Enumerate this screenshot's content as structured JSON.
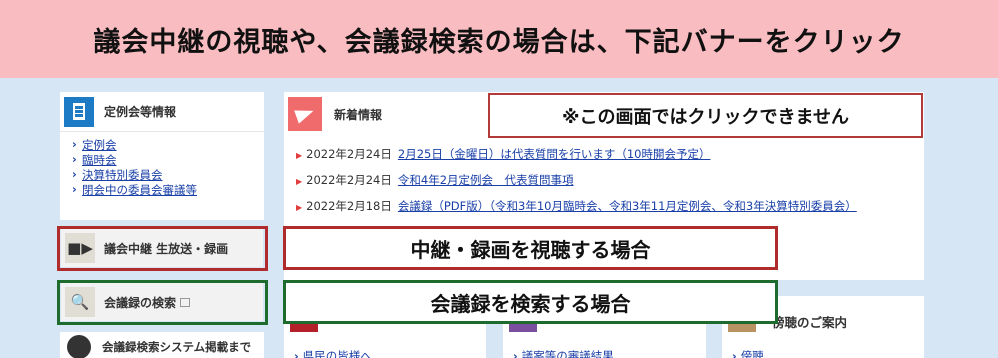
{
  "header_banner": "議会中継の視聴や、会議録検索の場合は、下記バナーをクリック",
  "notice": "※この画面ではクリックできません",
  "sidebar": {
    "title": "定例会等情報",
    "links": [
      "定例会",
      "臨時会",
      "決算特別委員会",
      "閉会中の委員会審議等"
    ],
    "broadcast_label": "議会中継 生放送・録画",
    "search_label": "会議録の検索",
    "system_label": "会議録検索システム掲載まで"
  },
  "news": {
    "title": "新着情報",
    "items": [
      {
        "date": "2022年2月24日",
        "text": "2月25日（金曜日）は代表質問を行います（10時開会予定）"
      },
      {
        "date": "2022年2月24日",
        "text": "令和4年2月定例会　代表質問事項"
      },
      {
        "date": "2022年2月18日",
        "text": "会議録（PDF版）（令和3年10月臨時会、令和3年11月定例会、令和3年決算特別委員会）"
      }
    ]
  },
  "callouts": {
    "broadcast": "中継・録画を視聴する場合",
    "search": "会議録を検索する場合"
  },
  "cards": {
    "a_link": "県民の皆様へ",
    "b_link": "議案等の審議結果",
    "c_title": "傍聴のご案内",
    "c_link": "傍聴"
  }
}
